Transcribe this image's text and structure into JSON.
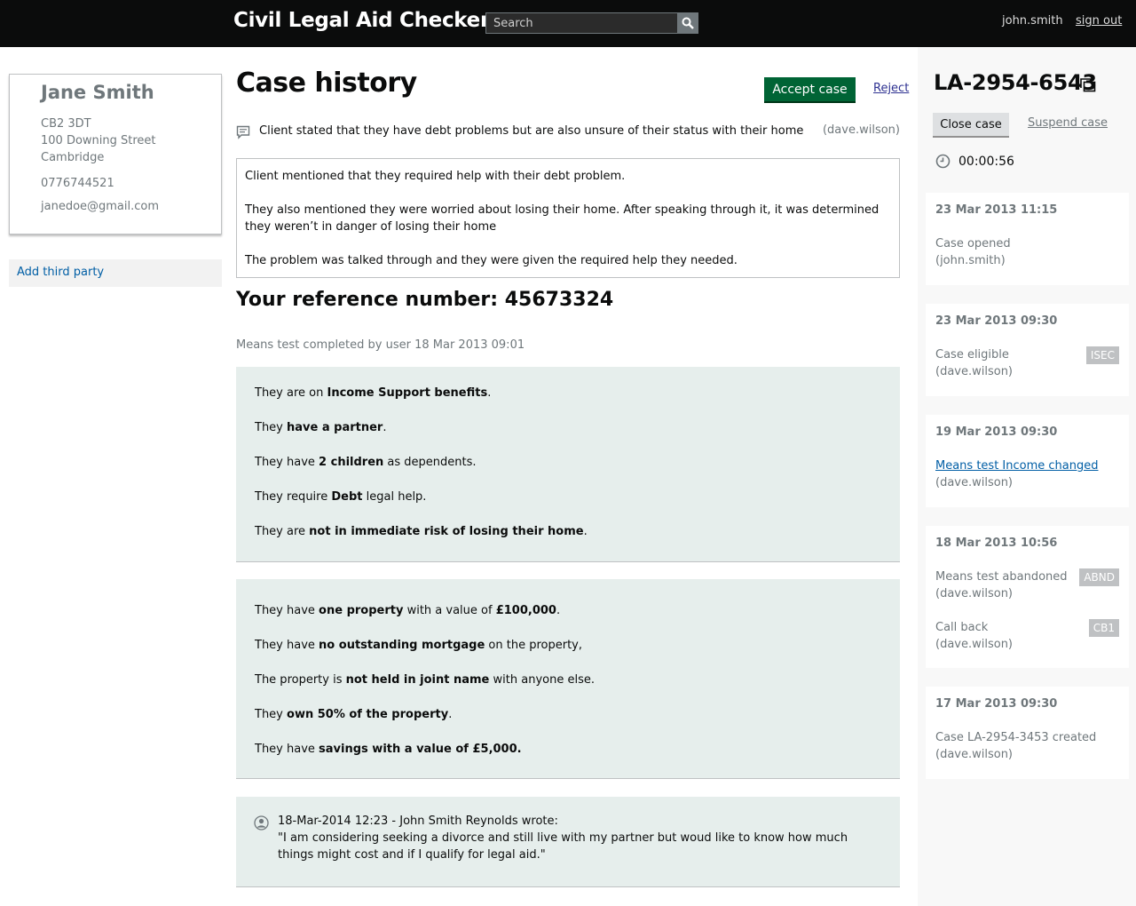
{
  "header": {
    "title": "Civil Legal Aid Checker",
    "search_placeholder": "Search",
    "user": "john.smith",
    "sign_out": "sign out"
  },
  "client": {
    "name": "Jane Smith",
    "postcode": "CB2 3DT",
    "street": "100 Downing Street",
    "city": "Cambridge",
    "phone": "0776744521",
    "email": "janedoe@gmail.com",
    "add_third_party": "Add third party"
  },
  "main": {
    "title": "Case history",
    "accept_label": "Accept case",
    "reject_label": "Reject",
    "summary": "Client stated that they have debt problems but are also unsure of their status with their home",
    "summary_author": "(dave.wilson)",
    "notes": [
      "Client mentioned that they required help with their debt problem.",
      "They also mentioned they were worried about losing their home. After speaking through it, it was determined they weren’t in danger of losing their home",
      "The problem was talked through and they were given the required help they needed."
    ],
    "reference_heading": "Your reference number: 45673324",
    "means_meta": "Means test completed by user 18 Mar 2013 09:01",
    "panel1": [
      {
        "pre": "They are on ",
        "bold": "Income Support benefits",
        "post": "."
      },
      {
        "pre": "They ",
        "bold": "have a partner",
        "post": "."
      },
      {
        "pre": "They have ",
        "bold": "2 children",
        "post": " as dependents."
      },
      {
        "pre": "They require ",
        "bold": "Debt",
        "post": " legal help."
      },
      {
        "pre": "They are ",
        "bold": "not in immediate risk of losing their home",
        "post": "."
      }
    ],
    "panel2": [
      {
        "pre": "They have ",
        "bold": "one property",
        "mid": " with a value of ",
        "bold2": "£100,000",
        "post": "."
      },
      {
        "pre": "They have ",
        "bold": "no outstanding mortgage",
        "post": " on the property,"
      },
      {
        "pre": "The property is ",
        "bold": "not held in joint name",
        "post": " with anyone else."
      },
      {
        "pre": " They ",
        "bold": "own 50% of the property",
        "post": "."
      },
      {
        "pre": "They have ",
        "bold": "savings with a value of £5,000.",
        "post": ""
      }
    ],
    "quote_head": "18-Mar-2014 12:23 - John Smith Reynolds wrote:",
    "quote_text": "\"I am considering seeking a divorce and still live with my partner but woud like to know how much things might cost and if I qualify for legal aid.\""
  },
  "sidebar": {
    "case_ref": "LA-2954-6543",
    "close_label": "Close case",
    "suspend_label": "Suspend case",
    "timer": "00:00:56",
    "events": [
      {
        "date": "23 Mar 2013 11:15",
        "items": [
          {
            "text": "Case opened",
            "by": "(john.smith)"
          }
        ]
      },
      {
        "date": "23 Mar 2013 09:30",
        "items": [
          {
            "text": "Case eligible",
            "by": "(dave.wilson)",
            "badge": "ISEC"
          }
        ]
      },
      {
        "date": "19 Mar 2013 09:30",
        "items": [
          {
            "text": "Means test Income changed",
            "by": "(dave.wilson)",
            "link": true
          }
        ]
      },
      {
        "date": "18 Mar 2013 10:56",
        "items": [
          {
            "text": "Means test abandoned",
            "by": "(dave.wilson)",
            "badge": "ABND"
          },
          {
            "text": "Call back",
            "by": "(dave.wilson)",
            "badge": "CB1"
          }
        ]
      },
      {
        "date": "17 Mar 2013 09:30",
        "items": [
          {
            "text": "Case LA-2954-3453 created",
            "by": "(dave.wilson)"
          }
        ]
      }
    ]
  }
}
